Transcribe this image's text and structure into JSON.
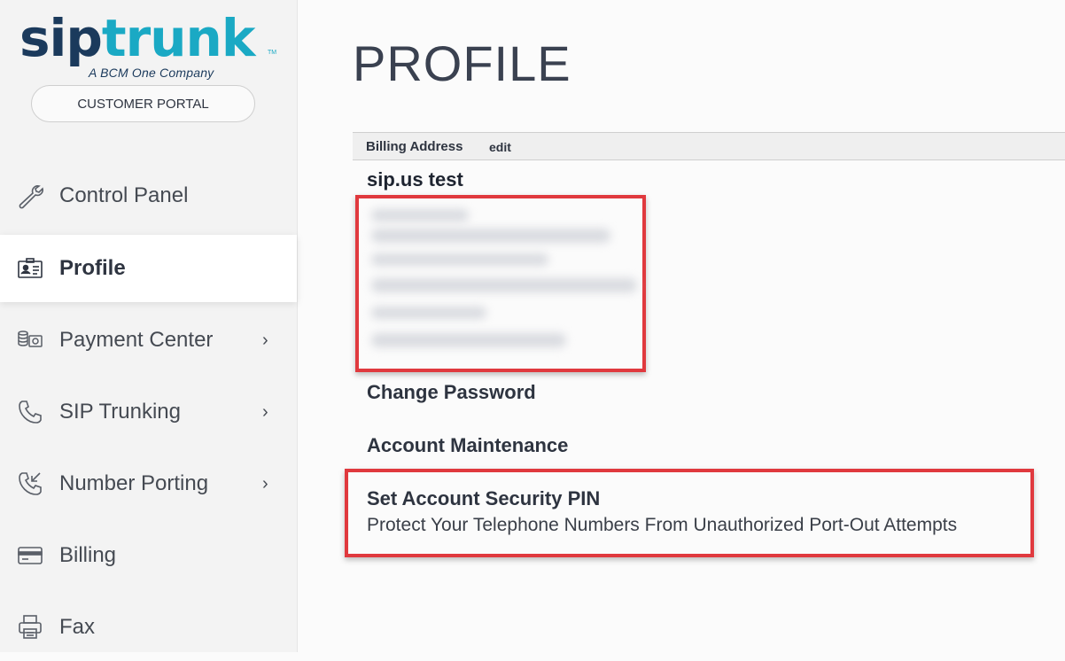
{
  "brand": {
    "logo_sip": "sip",
    "logo_trunk": "trunk",
    "tagline": "A BCM One Company",
    "tm": "TM"
  },
  "sidebar": {
    "portal_button": "CUSTOMER PORTAL",
    "items": [
      {
        "label": "Control Panel",
        "icon": "wrench-icon",
        "has_chevron": false,
        "active": false
      },
      {
        "label": "Profile",
        "icon": "id-card-icon",
        "has_chevron": false,
        "active": true
      },
      {
        "label": "Payment Center",
        "icon": "coins-icon",
        "has_chevron": true,
        "active": false
      },
      {
        "label": "SIP Trunking",
        "icon": "phone-icon",
        "has_chevron": true,
        "active": false
      },
      {
        "label": "Number Porting",
        "icon": "phone-incoming-icon",
        "has_chevron": true,
        "active": false
      },
      {
        "label": "Billing",
        "icon": "credit-card-icon",
        "has_chevron": false,
        "active": false
      },
      {
        "label": "Fax",
        "icon": "fax-icon",
        "has_chevron": false,
        "active": false
      }
    ],
    "chevron": "›"
  },
  "main": {
    "title": "PROFILE",
    "billing": {
      "title": "Billing Address",
      "edit_label": "edit",
      "account_name": "sip.us test"
    },
    "links": {
      "change_password": "Change Password",
      "account_maintenance": "Account Maintenance"
    },
    "security_pin": {
      "title": "Set Account Security PIN",
      "description": "Protect Your Telephone Numbers From Unauthorized Port-Out Attempts"
    }
  },
  "colors": {
    "highlight_border": "#e0393e",
    "brand_dark": "#1b3a5c",
    "brand_light": "#1aa9c4"
  }
}
